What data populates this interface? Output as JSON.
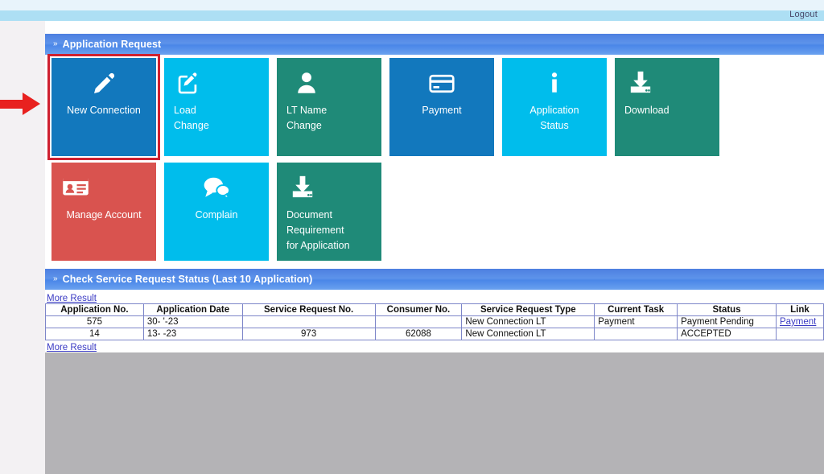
{
  "header": {
    "logout_label": "Logout"
  },
  "sections": {
    "application_request": {
      "chevron": "»",
      "title": "Application Request"
    },
    "service_status": {
      "chevron": "»",
      "title": "Check Service Request Status (Last 10 Application)"
    }
  },
  "tiles": {
    "row1": [
      {
        "id": "new-connection",
        "label": "New Connection",
        "icon": "pencil-icon",
        "color": "#1278bd",
        "selected": true
      },
      {
        "id": "load-change",
        "label": "Load\nChange",
        "icon": "edit-square-icon",
        "color": "#00bdec",
        "selected": false
      },
      {
        "id": "lt-name-change",
        "label": "LT Name\nChange",
        "icon": "user-icon",
        "color": "#1f8a78",
        "selected": false
      },
      {
        "id": "payment",
        "label": "Payment",
        "icon": "credit-card-icon",
        "color": "#1278bd",
        "selected": false
      },
      {
        "id": "application-status",
        "label": "Application\nStatus",
        "icon": "info-icon",
        "color": "#00bdec",
        "selected": false
      },
      {
        "id": "download",
        "label": "Download",
        "icon": "download-icon",
        "color": "#1f8a78",
        "selected": false
      }
    ],
    "row2": [
      {
        "id": "manage-account",
        "label": "Manage Account",
        "icon": "id-card-icon",
        "color": "#d9534f",
        "selected": false
      },
      {
        "id": "complain",
        "label": "Complain",
        "icon": "chat-bubble-icon",
        "color": "#00bdec",
        "selected": false
      },
      {
        "id": "document-requirement",
        "label": "Document\nRequirement\nfor Application",
        "icon": "download-icon",
        "color": "#1f8a78",
        "selected": false
      }
    ]
  },
  "more_result": {
    "top_label": "More Result",
    "bottom_label": "More Result"
  },
  "table": {
    "columns": [
      "Application No.",
      "Application Date",
      "Service Request No.",
      "Consumer No.",
      "Service Request Type",
      "Current Task",
      "Status",
      "Link"
    ],
    "rows": [
      {
        "application_no": "575",
        "application_date": "30-      '-23",
        "service_request_no": "",
        "consumer_no": "",
        "service_request_type": "New Connection LT",
        "current_task": "Payment",
        "status": "Payment Pending",
        "link": "Payment"
      },
      {
        "application_no": "14",
        "application_date": "13-     -23",
        "service_request_no": "973",
        "consumer_no": "62088",
        "service_request_type": "New Connection LT",
        "current_task": "",
        "status": "ACCEPTED",
        "link": ""
      }
    ]
  },
  "colors": {
    "tile_blue": "#1278bd",
    "tile_cyan": "#00bdec",
    "tile_teal": "#1f8a78",
    "tile_red": "#d9534f",
    "selection_outline": "#cf2030",
    "header_gradient_from": "#4d7fe0",
    "header_gradient_to": "#6aa1ef",
    "link": "#3b3bc4",
    "arrow": "#e8211f",
    "gray_panel": "#b4b3b6"
  },
  "annotation": {
    "arrow_icon": "red-right-arrow-icon"
  }
}
